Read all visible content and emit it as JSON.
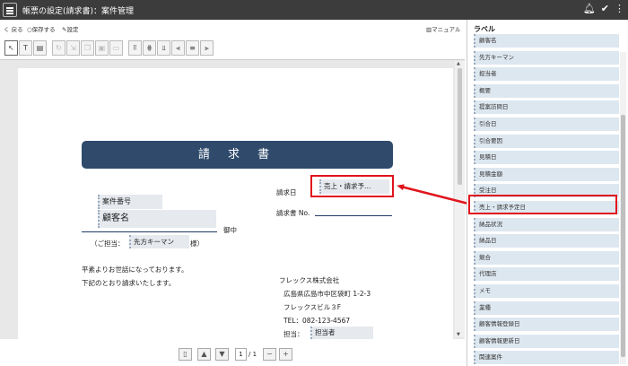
{
  "titlebar": {
    "title": "帳票の設定(請求書)：案件管理"
  },
  "toolbar": {
    "back": "く 戻る",
    "save": "保存する",
    "settings": "設定",
    "manual": "マニュアル"
  },
  "doc": {
    "title": "請 求 書",
    "case_number_label": "案件番号",
    "customer_label": "顧客名",
    "onchu": "御中",
    "tanto_prefix": "（ご担当：",
    "tanto_field": "先方キーマン",
    "tanto_suffix": "様）",
    "greeting1": "平素よりお世話になっております。",
    "greeting2": "下記のとおり請求いたします。",
    "invoice_date_label": "請求日",
    "invoice_date_field": "売上・請求予…",
    "invoice_no_label": "請求書 No.",
    "company": "フレックス株式会社",
    "address1": "広島県広島市中区袋町 1-2-3",
    "address2": "フレックスビル３F",
    "tel": "TEL：082-123-4567",
    "staff_label": "担当：",
    "staff_field": "担当者"
  },
  "pager": {
    "current": "1",
    "total": "/ 1"
  },
  "panel": {
    "title": "ラベル",
    "items": [
      "顧客名",
      "先方キーマン",
      "担当者",
      "概要",
      "提案訪問日",
      "引合日",
      "引合要因",
      "見積日",
      "見積金額",
      "受注日",
      "売上・請求予定日",
      "納品状況",
      "納品日",
      "競合",
      "代理店",
      "メモ",
      "業種",
      "顧客情報登録日",
      "顧客情報更新日",
      "関連案件",
      "登録者"
    ]
  }
}
